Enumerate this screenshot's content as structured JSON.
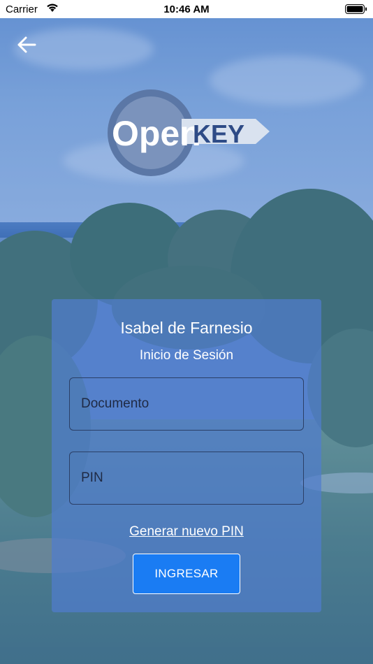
{
  "status_bar": {
    "carrier": "Carrier",
    "time": "10:46 AM",
    "wifi_icon": "wifi-icon",
    "battery_icon": "battery-full-icon"
  },
  "nav": {
    "back_icon": "arrow-left-icon"
  },
  "logo": {
    "word_open": "Open",
    "word_key": "KEY",
    "colors": {
      "ring": "#5b77a6",
      "text": "#ffffff",
      "key_text": "#2e4b86",
      "banner": "#d9e2ef"
    }
  },
  "login": {
    "title": "Isabel de Farnesio",
    "subtitle": "Inicio de Sesión",
    "documento_placeholder": "Documento",
    "pin_placeholder": "PIN",
    "new_pin_link": "Generar nuevo PIN",
    "submit_label": "INGRESAR"
  },
  "colors": {
    "card": "#507dcd",
    "button": "#1a7cf3",
    "field_border": "#2b3f66"
  }
}
